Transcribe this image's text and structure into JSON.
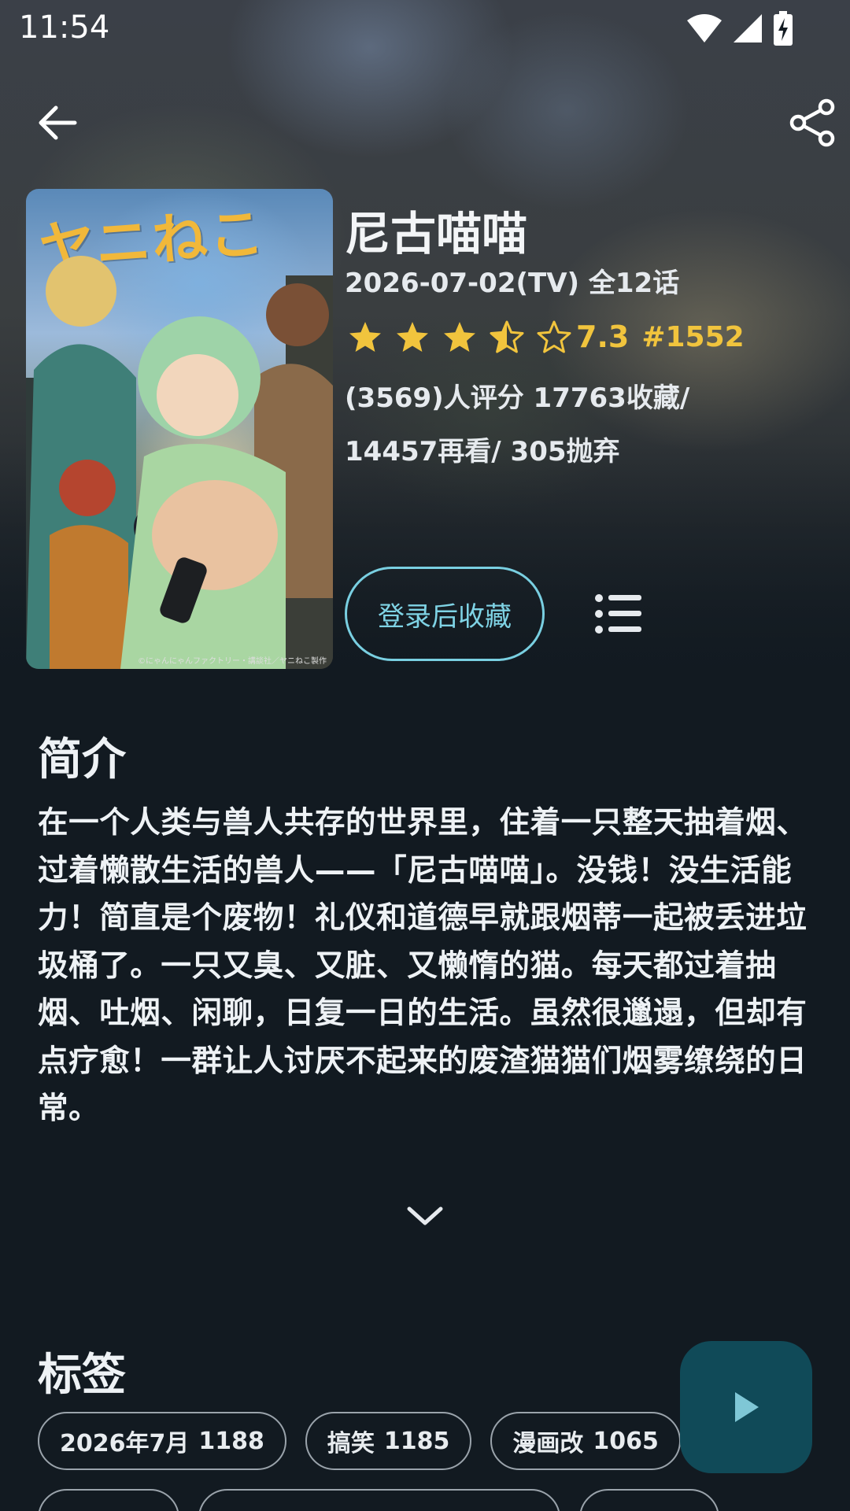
{
  "status_bar": {
    "time": "11:54"
  },
  "app_bar": {
    "back_icon": "arrow-left-icon",
    "share_icon": "share-icon"
  },
  "poster": {
    "title_art": "ヤニねこ",
    "credit": "©にゃんにゃんファクトリー・講談社／ヤニねこ製作"
  },
  "anime": {
    "title": "尼古喵喵",
    "airdate": "2026-07-02(TV)  全12话",
    "rating": {
      "score": "7.3",
      "rank": "#1552",
      "stars": 3.5,
      "max_stars": 5
    },
    "stats_line1": "(3569)人评分  17763收藏/",
    "stats_line2": "14457再看/  305抛弃"
  },
  "actions": {
    "collect_label": "登录后收藏",
    "list_icon": "list-icon"
  },
  "synopsis": {
    "heading": "简介",
    "text": "在一个人类与兽人共存的世界里，住着一只整天抽着烟、过着懒散生活的兽人——「尼古喵喵」。没钱！没生活能力！简直是个废物！礼仪和道德早就跟烟蒂一起被丢进垃圾桶了。一只又臭、又脏、又懒惰的猫。每天都过着抽烟、吐烟、闲聊，日复一日的生活。虽然很邋遢，但却有点疗愈！一群让人讨厌不起来的废渣猫猫们烟雾缭绕的日常。",
    "expand_icon": "chevron-down-icon"
  },
  "tags": {
    "heading": "标签",
    "row1": [
      {
        "name": "2026年7月",
        "count": "1188"
      },
      {
        "name": "搞笑",
        "count": "1185"
      },
      {
        "name": "漫画改",
        "count": "1065"
      }
    ]
  },
  "fab": {
    "icon": "play-icon"
  },
  "colors": {
    "accent": "#79cfe1",
    "star": "#f1c43d",
    "fab": "#104a58",
    "background": "#121a21"
  }
}
